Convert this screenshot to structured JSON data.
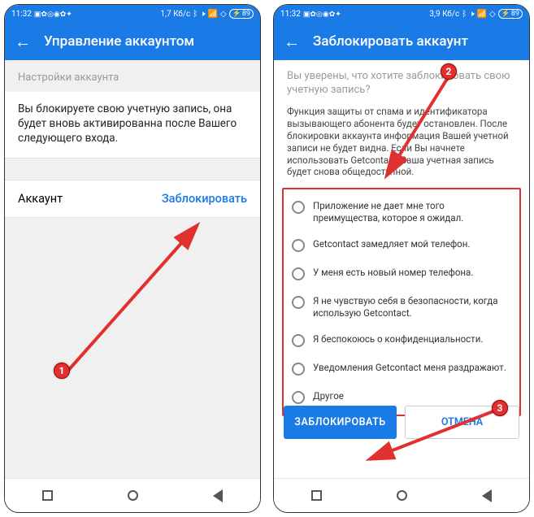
{
  "status": {
    "time": "11:32",
    "speed1": "1,7 Кб/с",
    "speed2": "3,9 Кб/с",
    "battery": "89"
  },
  "screen1": {
    "title": "Управление аккаунтом",
    "section": "Настройки аккаунта",
    "description": "Вы блокируете свою учетную запись, она будет вновь активированна после Вашего следующего входа.",
    "account_label": "Аккаунт",
    "block_link": "Заблокировать"
  },
  "screen2": {
    "title": "Заблокировать аккаунт",
    "question": "Вы уверены, что хотите заблокировать свою учетную запись?",
    "info": "Функция защиты от спама и идентификатора вызывающего абонента будет остановлен. После блокировки аккаунта информация Вашей учетной записи не будет видна. Если Вы начнете использовать Getcontact, Ваша учетная запись будет снова общедоступной.",
    "reasons": [
      "Приложение не дает мне того преимущества, которое я ожидал.",
      "Getcontact замедляет мой телефон.",
      "У меня есть новый номер телефона.",
      "Я не чувствую себя в безопасности, когда использую Getcontact.",
      "Я беспокоюсь о конфиденциальности.",
      "Уведомления Getcontact меня раздражают.",
      "Другое"
    ],
    "btn_block": "ЗАБЛОКИРОВАТЬ",
    "btn_cancel": "ОТМЕНА"
  },
  "badges": {
    "b1": "1",
    "b2": "2",
    "b3": "3"
  }
}
